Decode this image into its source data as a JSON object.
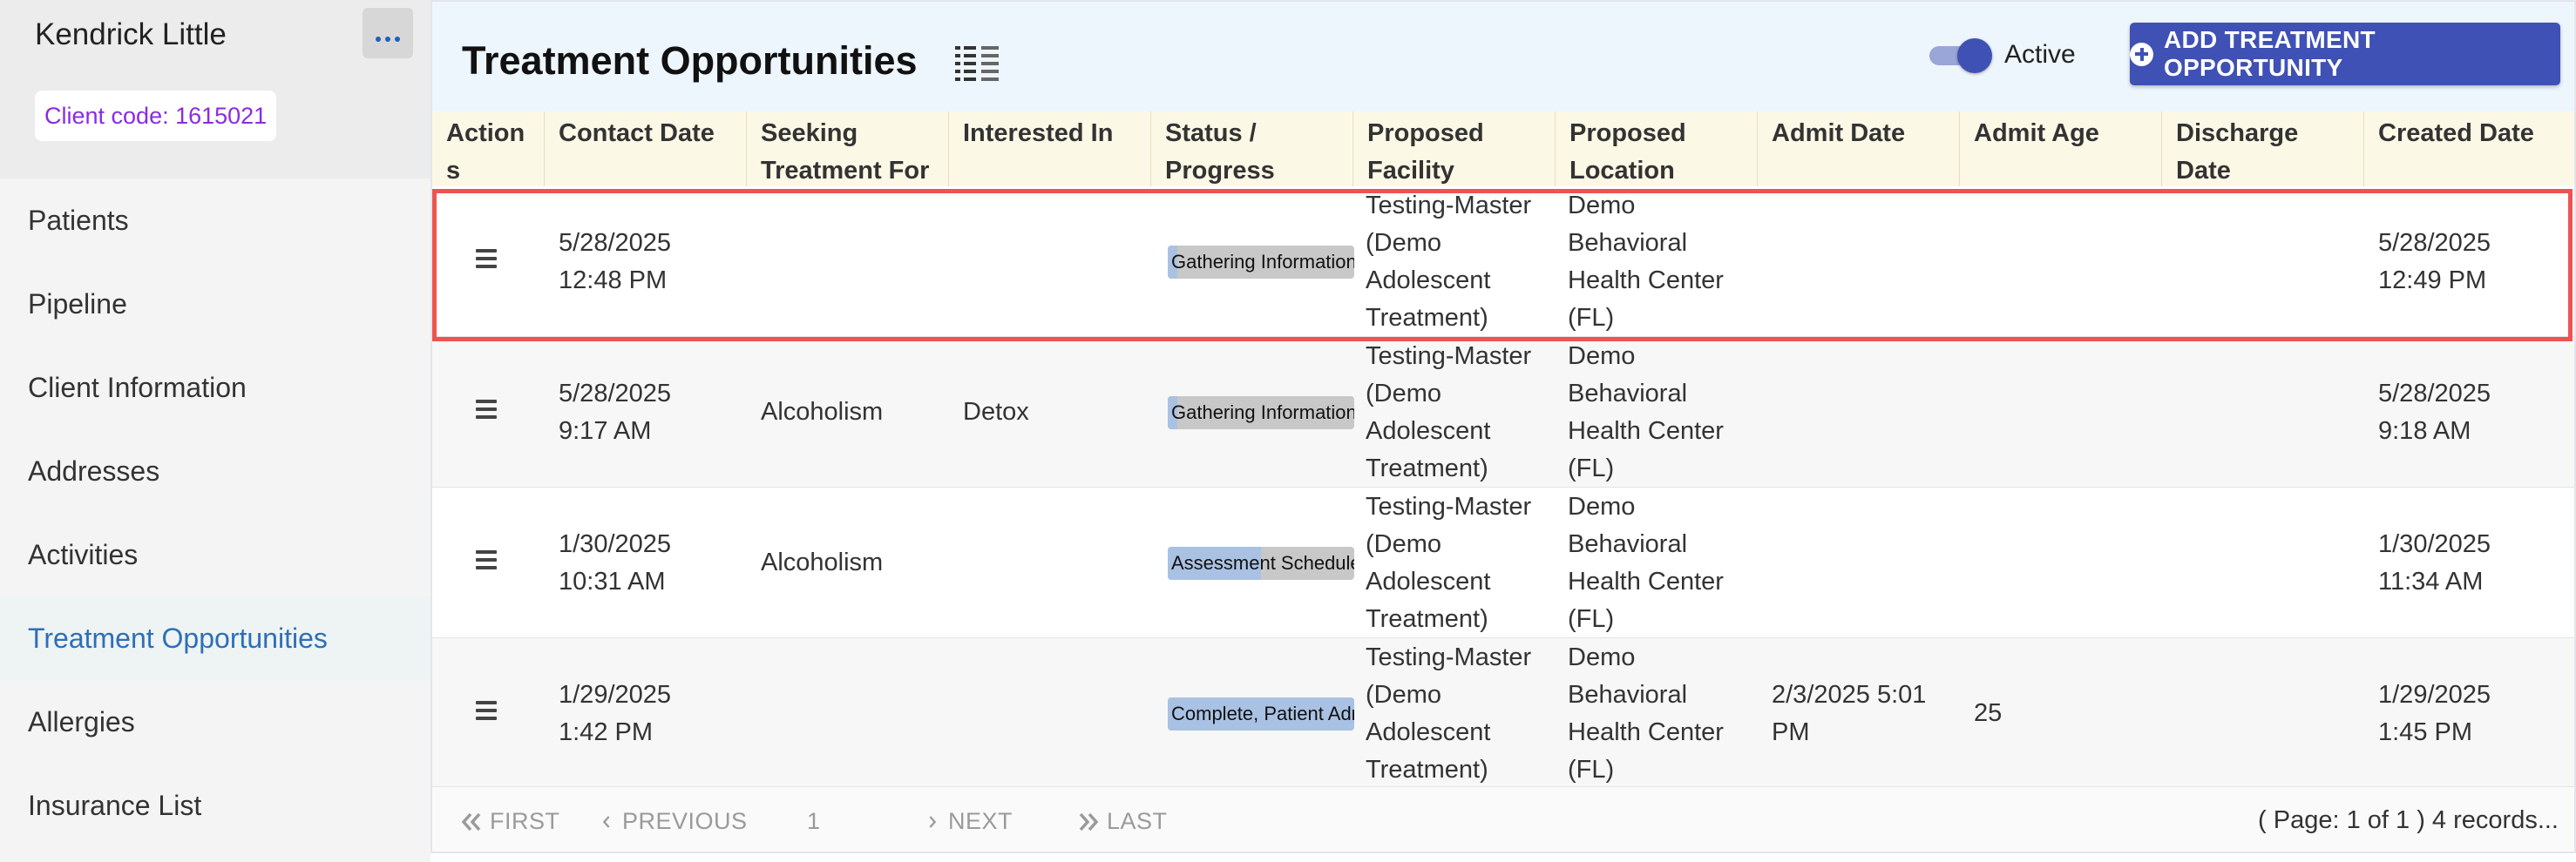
{
  "sidebar": {
    "client_name": "Kendrick Little",
    "client_code": "Client code: 1615021",
    "nav": [
      {
        "label": "Patients",
        "active": false
      },
      {
        "label": "Pipeline",
        "active": false
      },
      {
        "label": "Client Information",
        "active": false
      },
      {
        "label": "Addresses",
        "active": false
      },
      {
        "label": "Activities",
        "active": false
      },
      {
        "label": "Treatment Opportunities",
        "active": true
      },
      {
        "label": "Allergies",
        "active": false
      },
      {
        "label": "Insurance List",
        "active": false
      }
    ]
  },
  "header": {
    "title": "Treatment Opportunities",
    "toggle_label": "Active",
    "toggle_on": true,
    "add_button": "ADD TREATMENT OPPORTUNITY"
  },
  "table": {
    "columns": [
      "Actions",
      "Contact Date",
      "Seeking Treatment For",
      "Interested In",
      "Status / Progress",
      "Proposed Facility",
      "Proposed Location",
      "Admit Date",
      "Admit Age",
      "Discharge Date",
      "Created Date"
    ],
    "rows": [
      {
        "contact_date": "5/28/2025\n12:48 PM",
        "seeking": "",
        "interested": "",
        "status": "Gathering Information",
        "progress": 0.05,
        "facility": "Testing-Master\n(Demo\nAdolescent\nTreatment)",
        "location": "Demo\nBehavioral\nHealth Center\n(FL)",
        "admit_date": "",
        "admit_age": "",
        "discharge_date": "",
        "created_date": "5/28/2025\n12:49 PM"
      },
      {
        "contact_date": "5/28/2025\n9:17 AM",
        "seeking": "Alcoholism",
        "interested": "Detox",
        "status": "Gathering Information",
        "progress": 0.05,
        "facility": "Testing-Master\n(Demo\nAdolescent\nTreatment)",
        "location": "Demo\nBehavioral\nHealth Center\n(FL)",
        "admit_date": "",
        "admit_age": "",
        "discharge_date": "",
        "created_date": "5/28/2025\n9:18 AM"
      },
      {
        "contact_date": "1/30/2025\n10:31 AM",
        "seeking": "Alcoholism",
        "interested": "",
        "status": "Assessment Scheduled",
        "progress": 0.5,
        "facility": "Testing-Master\n(Demo\nAdolescent\nTreatment)",
        "location": "Demo\nBehavioral\nHealth Center\n(FL)",
        "admit_date": "",
        "admit_age": "",
        "discharge_date": "",
        "created_date": "1/30/2025\n11:34 AM"
      },
      {
        "contact_date": "1/29/2025\n1:42 PM",
        "seeking": "",
        "interested": "",
        "status": "Complete, Patient Admitted",
        "progress": 1.0,
        "facility": "Testing-Master\n(Demo\nAdolescent\nTreatment)",
        "location": "Demo\nBehavioral\nHealth Center\n(FL)",
        "admit_date": "2/3/2025 5:01\nPM",
        "admit_age": "25",
        "discharge_date": "",
        "created_date": "1/29/2025\n1:45 PM"
      }
    ]
  },
  "pagination": {
    "first": "FIRST",
    "previous": "PREVIOUS",
    "page": "1",
    "next": "NEXT",
    "last": "LAST",
    "info": "( Page: 1 of 1 ) 4 records..."
  },
  "colors": {
    "accent": "#3f51b5",
    "active_nav": "#2e6fb7",
    "client_code": "#8a2be2",
    "header_bg": "#eef6fd",
    "table_header_bg": "#fcf8e6",
    "highlight": "#ef5350",
    "progress_fill": "#a9c2e3"
  },
  "icons": {
    "more": "more-horizontal-icon",
    "title": "list-view-icon",
    "add": "plus-circle-icon",
    "row_action": "hamburger-menu-icon"
  }
}
